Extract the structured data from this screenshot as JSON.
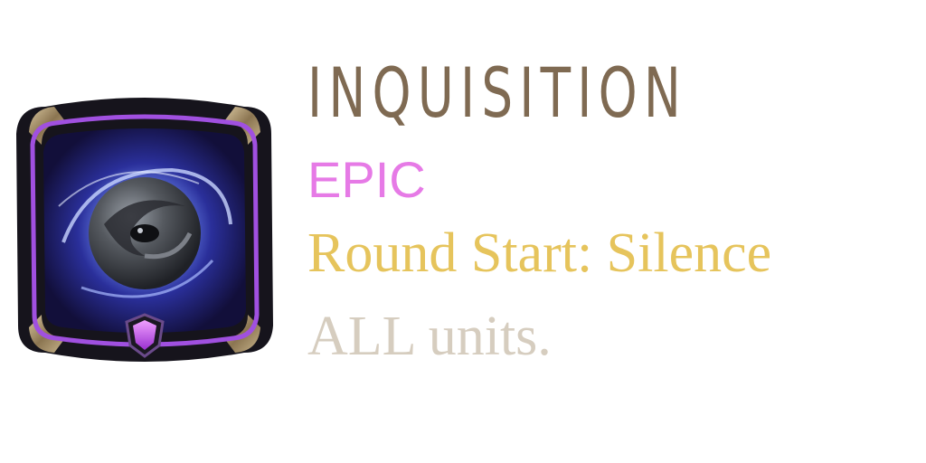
{
  "augment": {
    "name": "INQUISITION",
    "rarity": "EPIC",
    "description_line1": "Round Start: Silence",
    "description_line2": "ALL units.",
    "icon": "eye-orb-icon",
    "gem_icon": "purple-gem-icon"
  },
  "colors": {
    "title": "#7f6a52",
    "rarity": "#e67ae6",
    "description_highlight": "#e6c45c",
    "description_body": "#d6cdbf",
    "frame_gold": "#b39a6e",
    "frame_purple": "#a050e0",
    "orb_glow": "#5a78ff"
  }
}
